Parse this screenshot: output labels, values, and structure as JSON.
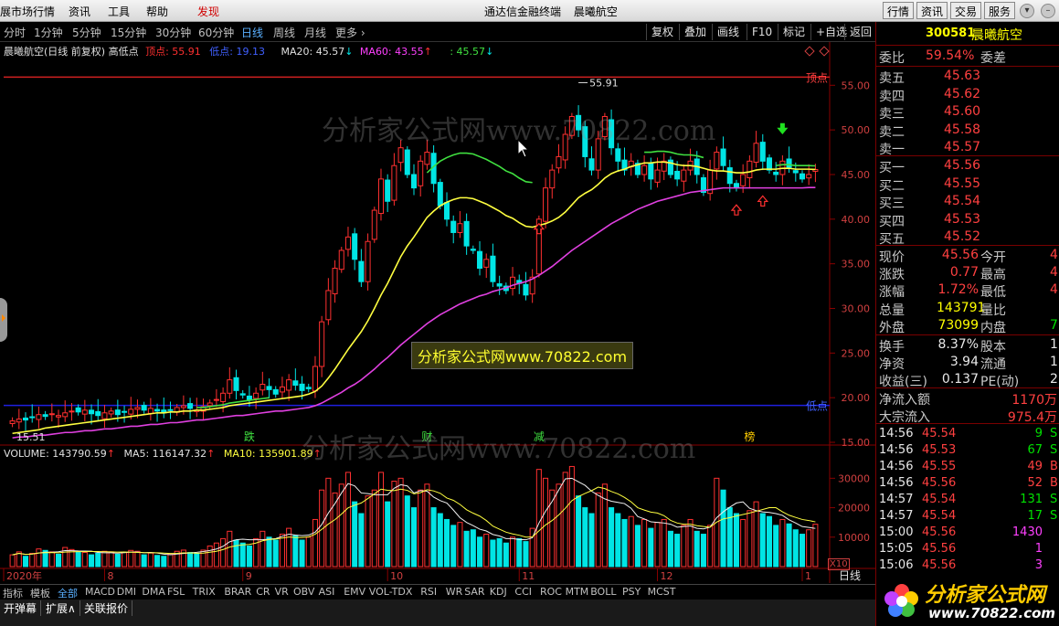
{
  "menubar": {
    "items": [
      "展市场行情",
      "资讯",
      "工具",
      "帮助",
      "发现"
    ],
    "active": "发现",
    "center_title": "通达信金融终端",
    "center_stock": "晨曦航空",
    "right_buttons": [
      "行情",
      "资讯",
      "交易",
      "服务"
    ],
    "window_icons": [
      "▾",
      "–",
      "⤢",
      "×"
    ]
  },
  "periodbar": {
    "periods": [
      "分时",
      "1分钟",
      "5分钟",
      "15分钟",
      "30分钟",
      "60分钟",
      "日线",
      "周线",
      "月线",
      "更多 ›"
    ],
    "selected": "日线",
    "tools": [
      "复权",
      "叠加",
      "画线",
      "F10",
      "标记",
      "+自选",
      "返回"
    ]
  },
  "chart_header": {
    "title": "晨曦航空(日线 前复权) 高低点",
    "top_label": "顶点: 55.91",
    "low_label": "低点: 19.13",
    "ma20": "MA20: 45.57",
    "ma60": "MA60: 43.55",
    "extra": ": 45.57"
  },
  "chart_labels": {
    "top_line": "顶点",
    "bottom_line": "低点",
    "high_mark": "55.91",
    "low_mark": "15.51",
    "events": [
      "跌",
      "财",
      "减",
      "榜"
    ]
  },
  "volume_header": {
    "volume": "VOLUME: 143790.59",
    "ma5": "MA5: 116147.32",
    "ma10": "MA10: 135901.89",
    "unit": "X10"
  },
  "date_axis": [
    "2020年",
    "8",
    "9",
    "10",
    "11",
    "12",
    "1"
  ],
  "period_indicator": "日线",
  "chart_data": {
    "type": "candlestick",
    "ylim_price": [
      15,
      58
    ],
    "price_ticks": [
      55.0,
      50.0,
      45.0,
      40.0,
      35.0,
      30.0,
      25.0,
      20.0,
      15.0
    ],
    "ylim_volume": [
      0,
      36000
    ],
    "volume_ticks": [
      30000,
      20000,
      10000
    ],
    "top_line_value": 55.91,
    "low_line_value": 19.13,
    "close": [
      17.4,
      17.6,
      17.5,
      17.8,
      18.1,
      17.9,
      18.2,
      18.0,
      18.3,
      18.5,
      18.4,
      18.6,
      18.2,
      18.0,
      18.3,
      18.5,
      18.1,
      18.4,
      18.7,
      18.9,
      18.6,
      18.8,
      18.5,
      18.3,
      18.6,
      18.9,
      19.1,
      18.8,
      18.6,
      19.0,
      19.4,
      19.8,
      20.5,
      22.0,
      20.8,
      20.3,
      19.8,
      20.5,
      21.5,
      20.9,
      20.4,
      21.2,
      22.0,
      21.4,
      20.8,
      21.0,
      23.5,
      28.5,
      32.0,
      34.5,
      36.5,
      38.0,
      35.5,
      33.0,
      37.5,
      41.0,
      44.5,
      42.0,
      46.0,
      48.0,
      45.0,
      43.5,
      46.5,
      47.5,
      44.0,
      41.5,
      40.0,
      38.5,
      39.5,
      37.0,
      36.5,
      34.5,
      35.5,
      33.0,
      32.5,
      32.0,
      33.5,
      32.8,
      31.5,
      33.5,
      40.0,
      43.5,
      45.5,
      47.0,
      49.5,
      51.5,
      50.0,
      47.0,
      45.5,
      49.0,
      51.5,
      48.0,
      46.5,
      45.5,
      46.5,
      45.0,
      46.0,
      44.5,
      45.5,
      46.5,
      45.0,
      44.5,
      45.5,
      46.5,
      45.0,
      43.0,
      45.5,
      47.5,
      46.0,
      44.0,
      43.5,
      45.0,
      46.5,
      48.5,
      46.5,
      45.5,
      45.0,
      46.5,
      45.8,
      45.2,
      44.5,
      45.0,
      45.56
    ],
    "ma20": [
      16.0,
      16.1,
      16.2,
      16.3,
      16.4,
      16.6,
      16.7,
      16.8,
      16.9,
      17.0,
      17.1,
      17.2,
      17.3,
      17.4,
      17.5,
      17.6,
      17.7,
      17.8,
      17.9,
      18.0,
      18.1,
      18.2,
      18.3,
      18.3,
      18.4,
      18.4,
      18.5,
      18.5,
      18.6,
      18.6,
      18.7,
      18.8,
      18.9,
      19.1,
      19.2,
      19.3,
      19.4,
      19.5,
      19.6,
      19.7,
      19.8,
      19.9,
      20.0,
      20.1,
      20.2,
      20.4,
      20.7,
      21.3,
      22.2,
      23.2,
      24.3,
      25.4,
      26.4,
      27.4,
      28.6,
      30.0,
      31.5,
      32.8,
      34.3,
      35.8,
      37.0,
      38.0,
      39.1,
      40.2,
      40.9,
      41.5,
      41.9,
      42.2,
      42.4,
      42.4,
      42.3,
      42.0,
      41.7,
      41.3,
      40.9,
      40.4,
      40.1,
      39.6,
      39.2,
      39.1,
      39.3,
      39.5,
      39.8,
      40.2,
      40.8,
      41.6,
      42.4,
      42.9,
      43.3,
      43.9,
      44.6,
      45.1,
      45.4,
      45.6,
      45.9,
      46.1,
      46.3,
      46.3,
      46.4,
      46.4,
      46.3,
      46.1,
      46.0,
      46.0,
      45.9,
      45.7,
      45.5,
      45.4,
      45.4,
      45.3,
      45.2,
      45.2,
      45.3,
      45.5,
      45.6,
      45.6,
      45.6,
      45.7,
      45.7,
      45.6,
      45.6,
      45.6,
      45.57
    ],
    "ma60": [
      15.5,
      15.6,
      15.6,
      15.7,
      15.8,
      15.8,
      15.9,
      16.0,
      16.1,
      16.1,
      16.2,
      16.3,
      16.3,
      16.4,
      16.5,
      16.5,
      16.6,
      16.7,
      16.8,
      16.8,
      16.9,
      17.0,
      17.0,
      17.1,
      17.2,
      17.2,
      17.3,
      17.4,
      17.5,
      17.5,
      17.6,
      17.7,
      17.8,
      17.9,
      18.0,
      18.0,
      18.1,
      18.2,
      18.3,
      18.4,
      18.5,
      18.5,
      18.6,
      18.7,
      18.8,
      18.9,
      19.1,
      19.4,
      19.8,
      20.2,
      20.6,
      21.1,
      21.5,
      22.0,
      22.6,
      23.2,
      23.9,
      24.5,
      25.2,
      25.9,
      26.5,
      27.1,
      27.7,
      28.3,
      28.8,
      29.3,
      29.7,
      30.1,
      30.5,
      30.8,
      31.1,
      31.4,
      31.6,
      31.9,
      32.1,
      32.3,
      32.6,
      32.8,
      33.0,
      33.3,
      33.7,
      34.2,
      34.7,
      35.3,
      35.9,
      36.5,
      37.0,
      37.5,
      38.0,
      38.5,
      39.0,
      39.5,
      39.9,
      40.3,
      40.7,
      41.1,
      41.4,
      41.7,
      42.0,
      42.2,
      42.4,
      42.6,
      42.8,
      43.0,
      43.1,
      43.2,
      43.3,
      43.4,
      43.5,
      43.5,
      43.5,
      43.5,
      43.5,
      43.5,
      43.5,
      43.5,
      43.5,
      43.5,
      43.5,
      43.5,
      43.5,
      43.55,
      43.55
    ],
    "volume": [
      4000,
      5000,
      3500,
      4500,
      6000,
      5500,
      5000,
      4200,
      6500,
      5800,
      5000,
      4800,
      4000,
      4500,
      5200,
      5000,
      4200,
      4800,
      5500,
      5200,
      4000,
      4600,
      3800,
      3500,
      4200,
      5200,
      5600,
      4800,
      4400,
      5600,
      7000,
      8000,
      9500,
      12000,
      9000,
      8000,
      7000,
      9500,
      12000,
      10000,
      9000,
      11000,
      13000,
      10500,
      9000,
      10000,
      16000,
      26000,
      30000,
      25000,
      28000,
      32000,
      22000,
      18000,
      24000,
      26000,
      32000,
      22000,
      29000,
      30000,
      24000,
      20000,
      26000,
      28000,
      20000,
      18000,
      16000,
      14000,
      15000,
      12000,
      12500,
      10000,
      11000,
      9000,
      9500,
      8000,
      10000,
      9500,
      8500,
      13000,
      33000,
      30000,
      26000,
      28000,
      32000,
      34000,
      24000,
      20000,
      18000,
      25000,
      28000,
      20000,
      18000,
      16000,
      17000,
      14000,
      16000,
      13000,
      15000,
      16000,
      12000,
      11000,
      14000,
      16000,
      12000,
      11000,
      14000,
      30000,
      26000,
      20000,
      18000,
      16000,
      19000,
      22000,
      18000,
      17000,
      14000,
      16000,
      14500,
      12500,
      11000,
      12500,
      14379
    ]
  },
  "rpanel": {
    "code": "300581",
    "name": "晨曦航空",
    "webi_label": "委比",
    "webi_value": "59.54%",
    "wecha_label": "委差",
    "asks": [
      {
        "label": "卖五",
        "price": "45.63"
      },
      {
        "label": "卖四",
        "price": "45.62"
      },
      {
        "label": "卖三",
        "price": "45.60"
      },
      {
        "label": "卖二",
        "price": "45.58"
      },
      {
        "label": "卖一",
        "price": "45.57"
      }
    ],
    "bids": [
      {
        "label": "买一",
        "price": "45.56"
      },
      {
        "label": "买二",
        "price": "45.55"
      },
      {
        "label": "买三",
        "price": "45.54"
      },
      {
        "label": "买四",
        "price": "45.53"
      },
      {
        "label": "买五",
        "price": "45.52"
      }
    ],
    "quote": [
      {
        "l1": "现价",
        "v1": "45.56",
        "l2": "今开",
        "v2": "4"
      },
      {
        "l1": "涨跌",
        "v1": "0.77",
        "l2": "最高",
        "v2": "4"
      },
      {
        "l1": "涨幅",
        "v1": "1.72%",
        "l2": "最低",
        "v2": "4"
      },
      {
        "l1": "总量",
        "v1": "143791",
        "l2": "量比",
        "v2": ""
      },
      {
        "l1": "外盘",
        "v1": "73099",
        "l2": "内盘",
        "v2": "7"
      }
    ],
    "fund": [
      {
        "l1": "换手",
        "v1": "8.37%",
        "l2": "股本",
        "v2": "1."
      },
      {
        "l1": "净资",
        "v1": "3.94",
        "l2": "流通",
        "v2": "1."
      },
      {
        "l1": "收益(三)",
        "v1": "0.137",
        "l2": "PE(动)",
        "v2": "2"
      }
    ],
    "flow": [
      {
        "label": "净流入额",
        "value": "1170万"
      },
      {
        "label": "大宗流入",
        "value": "975.4万"
      }
    ],
    "ticks": [
      {
        "time": "14:56",
        "price": "45.54",
        "vol": "9",
        "side": "S"
      },
      {
        "time": "14:56",
        "price": "45.53",
        "vol": "67",
        "side": "S"
      },
      {
        "time": "14:56",
        "price": "45.55",
        "vol": "49",
        "side": "B"
      },
      {
        "time": "14:56",
        "price": "45.56",
        "vol": "52",
        "side": "B"
      },
      {
        "time": "14:57",
        "price": "45.54",
        "vol": "131",
        "side": "S"
      },
      {
        "time": "14:57",
        "price": "45.54",
        "vol": "17",
        "side": "S"
      },
      {
        "time": "15:00",
        "price": "45.56",
        "vol": "1430",
        "side": ""
      },
      {
        "time": "15:05",
        "price": "45.56",
        "vol": "1",
        "side": ""
      },
      {
        "time": "15:06",
        "price": "45.56",
        "vol": "3",
        "side": ""
      }
    ]
  },
  "indicator_tabs": [
    "指标",
    "模板",
    "全部",
    "MACD",
    "DMI",
    "DMA",
    "FSL",
    "TRIX",
    "BRAR",
    "CR",
    "VR",
    "OBV",
    "ASI",
    "EMV",
    "VOL-TDX",
    "RSI",
    "WR",
    "SAR",
    "KDJ",
    "CCI",
    "ROC",
    "MTM",
    "BOLL",
    "PSY",
    "MCST"
  ],
  "indicator_selected": "全部",
  "bottom_tabs": [
    "开弹幕",
    "扩展∧",
    "关联报价"
  ],
  "watermarks": {
    "w1": "分析家公式网www.70822.com",
    "w2": "分析家公式网www.70822.com",
    "w3": "分析家公式网www.70822.com"
  },
  "logo": {
    "line1": "分析家公式网",
    "line2": "www.70822.com"
  },
  "colors": {
    "up": "#ff3030",
    "down": "#00e5e5",
    "ma20": "#ffff40",
    "ma60": "#e040e0",
    "ma_green": "#40e040",
    "top_line": "#d02020",
    "low_line": "#2020e0"
  }
}
